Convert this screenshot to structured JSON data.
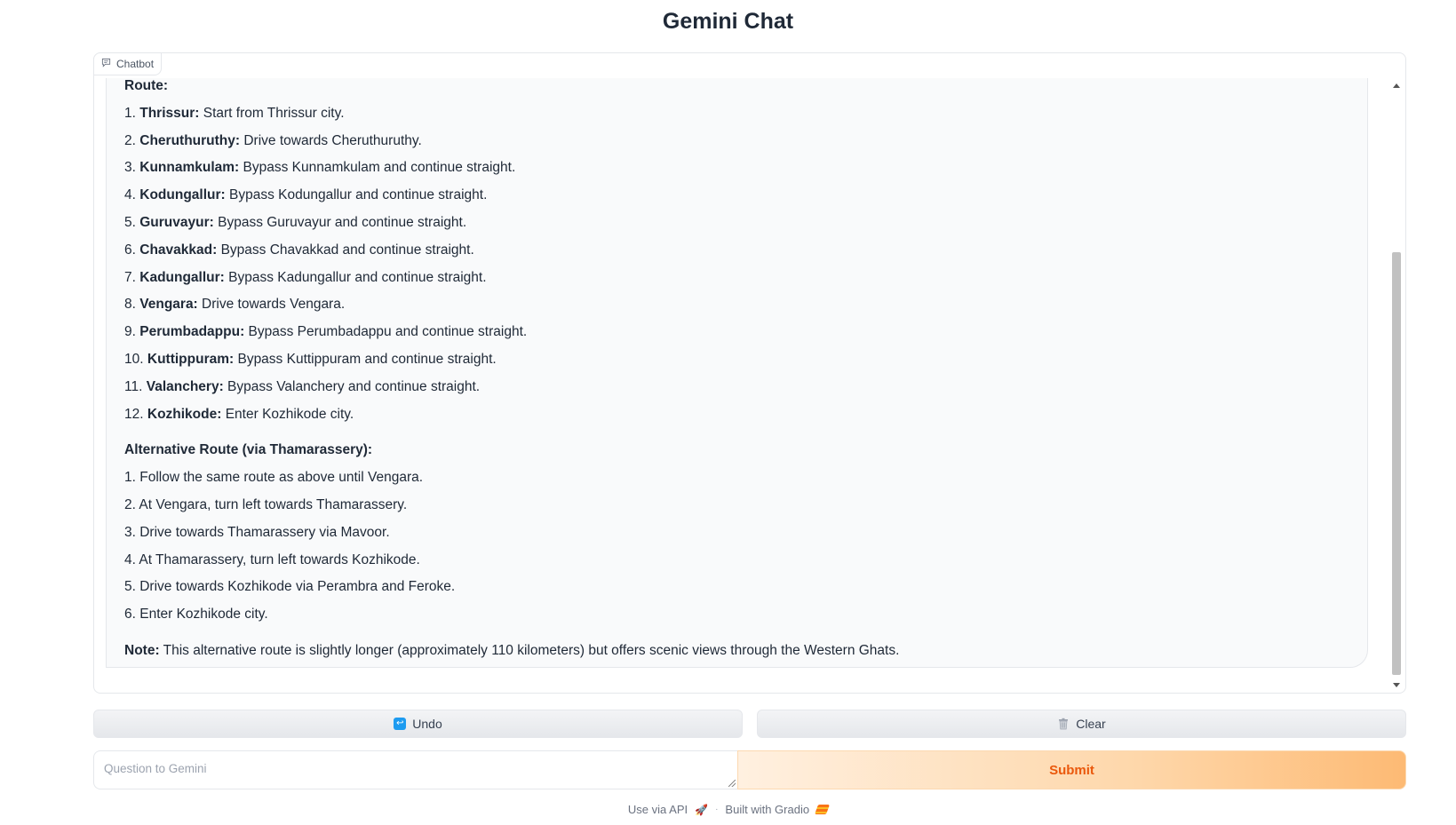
{
  "header": {
    "title": "Gemini Chat"
  },
  "chatbot": {
    "label": "Chatbot",
    "route_heading": "Route:",
    "route_steps": [
      {
        "num": "1.",
        "place": "Thrissur:",
        "text": " Start from Thrissur city."
      },
      {
        "num": "2.",
        "place": "Cheruthuruthy:",
        "text": " Drive towards Cheruthuruthy."
      },
      {
        "num": "3.",
        "place": "Kunnamkulam:",
        "text": " Bypass Kunnamkulam and continue straight."
      },
      {
        "num": "4.",
        "place": "Kodungallur:",
        "text": " Bypass Kodungallur and continue straight."
      },
      {
        "num": "5.",
        "place": "Guruvayur:",
        "text": " Bypass Guruvayur and continue straight."
      },
      {
        "num": "6.",
        "place": "Chavakkad:",
        "text": " Bypass Chavakkad and continue straight."
      },
      {
        "num": "7.",
        "place": "Kadungallur:",
        "text": " Bypass Kadungallur and continue straight."
      },
      {
        "num": "8.",
        "place": "Vengara:",
        "text": " Drive towards Vengara."
      },
      {
        "num": "9.",
        "place": "Perumbadappu:",
        "text": " Bypass Perumbadappu and continue straight."
      },
      {
        "num": "10.",
        "place": "Kuttippuram:",
        "text": " Bypass Kuttippuram and continue straight."
      },
      {
        "num": "11.",
        "place": "Valanchery:",
        "text": " Bypass Valanchery and continue straight."
      },
      {
        "num": "12.",
        "place": "Kozhikode:",
        "text": " Enter Kozhikode city."
      }
    ],
    "alt_heading": "Alternative Route (via Thamarassery):",
    "alt_steps": [
      "1. Follow the same route as above until Vengara.",
      "2. At Vengara, turn left towards Thamarassery.",
      "3. Drive towards Thamarassery via Mavoor.",
      "4. At Thamarassery, turn left towards Kozhikode.",
      "5. Drive towards Kozhikode via Perambra and Feroke.",
      "6. Enter Kozhikode city."
    ],
    "note_label": "Note:",
    "note_text": " This alternative route is slightly longer (approximately 110 kilometers) but offers scenic views through the Western Ghats."
  },
  "actions": {
    "undo_label": "Undo",
    "clear_label": "Clear"
  },
  "input": {
    "placeholder": "Question to Gemini",
    "value": ""
  },
  "submit": {
    "label": "Submit"
  },
  "footer": {
    "api_link": "Use via API",
    "separator": "·",
    "built_with": "Built with Gradio"
  },
  "colors": {
    "submit_text": "#ea580c",
    "submit_gradient_end": "#fdba74",
    "undo_icon": "#1d9bf0"
  }
}
